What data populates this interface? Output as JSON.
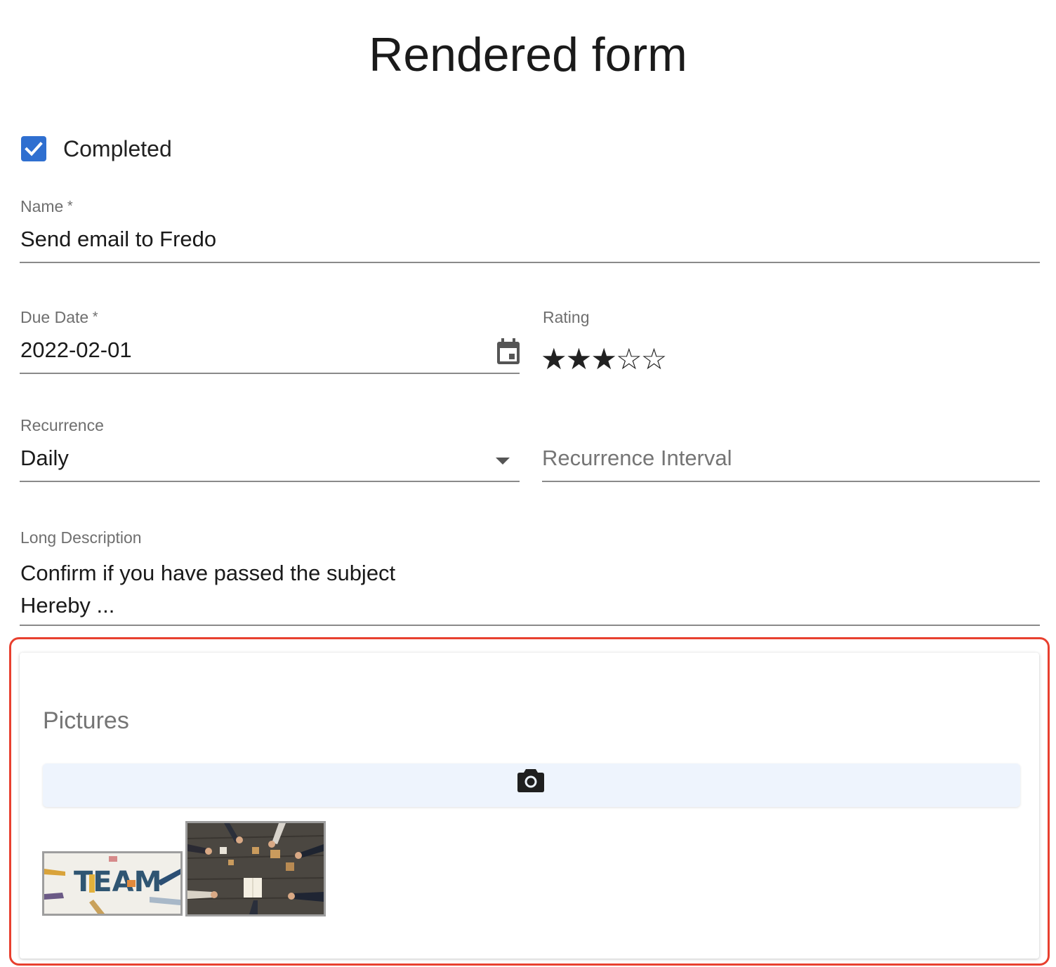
{
  "page": {
    "title": "Rendered form"
  },
  "completed": {
    "label": "Completed",
    "checked": true
  },
  "name": {
    "label": "Name",
    "value": "Send email to Fredo"
  },
  "due_date": {
    "label": "Due Date",
    "value": "2022-02-01",
    "icon": "calendar-icon"
  },
  "rating": {
    "label": "Rating",
    "value": 3,
    "max": 5,
    "filled_glyph": "★",
    "empty_glyph": "☆"
  },
  "recurrence": {
    "label": "Recurrence",
    "value": "Daily",
    "icon": "dropdown-arrow-icon"
  },
  "recurrence_interval": {
    "placeholder": "Recurrence Interval"
  },
  "long_description": {
    "label": "Long Description",
    "line1": "Confirm if you have passed the subject",
    "line2": "Hereby ..."
  },
  "pictures": {
    "title": "Pictures",
    "camera_icon": "camera-icon",
    "thumbnails": [
      {
        "name": "team-letters-image",
        "caption": "TEAM"
      },
      {
        "name": "team-puzzle-table-image"
      }
    ]
  },
  "colors": {
    "accent": "#2f6fd0",
    "highlight": "#e8402f",
    "camera_button_bg": "#eef4fd"
  }
}
